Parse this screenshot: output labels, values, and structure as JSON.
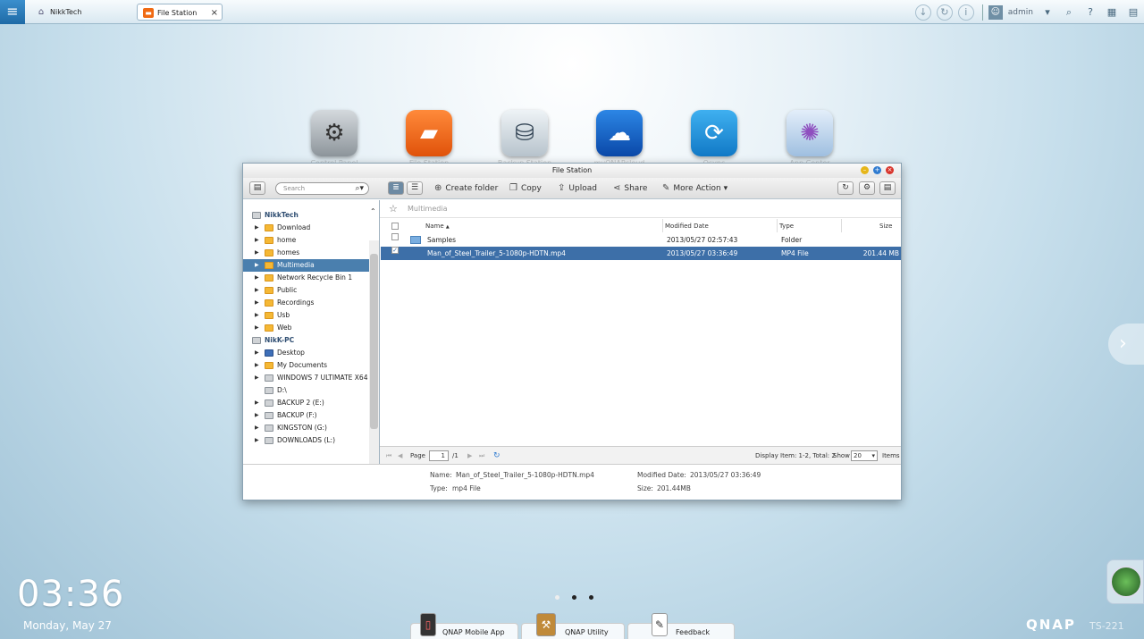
{
  "topbar": {
    "menu_icon": "hamburger-icon",
    "tabs": [
      {
        "label": "NikkTech",
        "icon": "home-icon"
      },
      {
        "label": "File Station",
        "icon": "folder-icon",
        "close": "×"
      }
    ],
    "user": "admin",
    "icons": [
      "download-icon",
      "sync-icon",
      "info-icon",
      "user-icon",
      "search-icon",
      "help-icon",
      "grid-icon",
      "options-icon"
    ]
  },
  "desktop_icons": [
    {
      "label": "Control Panel",
      "icon": "gear-icon",
      "color": "#9aa2a8"
    },
    {
      "label": "File Station",
      "icon": "folder-icon",
      "color": "#f06a13"
    },
    {
      "label": "Backup Station",
      "icon": "backup-icon",
      "color": "#c9d2d9"
    },
    {
      "label": "myQNAPcloud",
      "icon": "cloud-icon",
      "color": "#1464c4"
    },
    {
      "label": "Qsync",
      "icon": "sync-icon",
      "color": "#1b8fdb"
    },
    {
      "label": "App Center",
      "icon": "app-icon",
      "color": "#a9c8e8"
    }
  ],
  "window": {
    "title": "File Station",
    "search_placeholder": "Search",
    "toolbar": {
      "create_folder": "Create folder",
      "copy": "Copy",
      "upload": "Upload",
      "share": "Share",
      "more_action": "More Action"
    },
    "tree": [
      {
        "label": "NikkTech",
        "root": true
      },
      {
        "label": "Download"
      },
      {
        "label": "home"
      },
      {
        "label": "homes"
      },
      {
        "label": "Multimedia",
        "selected": true
      },
      {
        "label": "Network Recycle Bin 1"
      },
      {
        "label": "Public"
      },
      {
        "label": "Recordings"
      },
      {
        "label": "Usb"
      },
      {
        "label": "Web"
      },
      {
        "label": "NikK-PC",
        "root": true
      },
      {
        "label": "Desktop"
      },
      {
        "label": "My Documents"
      },
      {
        "label": "WINDOWS 7 ULTIMATE X64 ("
      },
      {
        "label": "D:\\"
      },
      {
        "label": "BACKUP 2 (E:)"
      },
      {
        "label": "BACKUP (F:)"
      },
      {
        "label": "KINGSTON (G:)"
      },
      {
        "label": "DOWNLOADS (L:)"
      }
    ],
    "breadcrumb": "Multimedia",
    "columns": {
      "name": "Name",
      "sort_indicator": "▲",
      "modified": "Modified Date",
      "type": "Type",
      "size": "Size"
    },
    "rows": [
      {
        "name": "Samples",
        "modified": "2013/05/27 02:57:43",
        "type": "Folder",
        "size": "",
        "selected": false
      },
      {
        "name": "Man_of_Steel_Trailer_5-1080p-HDTN.mp4",
        "modified": "2013/05/27 03:36:49",
        "type": "MP4 File",
        "size": "201.44 MB",
        "selected": true
      }
    ],
    "pager": {
      "page_label": "Page",
      "page": "1",
      "total_pages": "/1",
      "display": "Display Item: 1-2, Total: 2",
      "show_label": "Show",
      "show_value": "20",
      "items_label": "Items"
    },
    "info": {
      "name_label": "Name:",
      "name": "Man_of_Steel_Trailer_5-1080p-HDTN.mp4",
      "modified_label": "Modified Date:",
      "modified": "2013/05/27 03:36:49",
      "type_label": "Type:",
      "type": "mp4 File",
      "size_label": "Size:",
      "size": "201.44MB"
    }
  },
  "clock": {
    "time": "03:36",
    "date": "Monday, May 27"
  },
  "dock": [
    {
      "label": "QNAP Mobile App",
      "icon": "phone-icon"
    },
    {
      "label": "QNAP Utility",
      "icon": "toolbox-icon"
    },
    {
      "label": "Feedback",
      "icon": "feedback-icon"
    }
  ],
  "brand": {
    "logo": "QNAP",
    "model": "TS-221"
  }
}
